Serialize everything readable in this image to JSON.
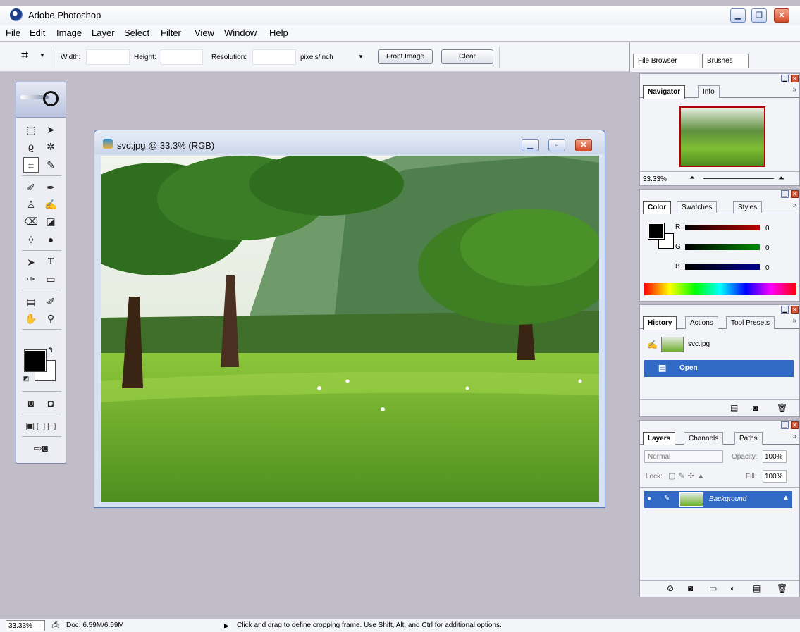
{
  "app": {
    "title": "Adobe Photoshop"
  },
  "menu": [
    "File",
    "Edit",
    "Image",
    "Layer",
    "Select",
    "Filter",
    "View",
    "Window",
    "Help"
  ],
  "options": {
    "width_label": "Width:",
    "height_label": "Height:",
    "resolution_label": "Resolution:",
    "units_value": "pixels/inch",
    "front_image_label": "Front Image",
    "clear_label": "Clear",
    "arrow": "▼"
  },
  "palette_well": {
    "tabs": [
      "File Browser",
      "Brushes"
    ]
  },
  "document": {
    "title": "svc.jpg @ 33.3% (RGB)"
  },
  "navigator": {
    "tabs": [
      "Navigator",
      "Info"
    ],
    "zoom": "33.33%"
  },
  "color_panel": {
    "tabs": [
      "Color",
      "Swatches",
      "Styles"
    ],
    "channels": [
      {
        "label": "R",
        "value": "0",
        "color": "#c00000"
      },
      {
        "label": "G",
        "value": "0",
        "color": "#008a00"
      },
      {
        "label": "B",
        "value": "0",
        "color": "#00008a"
      }
    ]
  },
  "history_panel": {
    "tabs": [
      "History",
      "Actions",
      "Tool Presets"
    ],
    "snapshot_name": "svc.jpg",
    "state": "Open"
  },
  "layers_panel": {
    "tabs": [
      "Layers",
      "Channels",
      "Paths"
    ],
    "blend_mode": "Normal",
    "opacity_label": "Opacity:",
    "opacity_value": "100%",
    "lock_label": "Lock:",
    "fill_label": "Fill:",
    "fill_value": "100%",
    "layer_name": "Background"
  },
  "status": {
    "zoom": "33.33%",
    "doc": "Doc: 6.59M/6.59M",
    "hint": "Click and drag to define cropping frame. Use Shift, Alt, and Ctrl for additional options."
  },
  "colors": {
    "selection": "#316ac5",
    "nav_frame": "#b00000",
    "workspace": "#c0bcc8"
  }
}
